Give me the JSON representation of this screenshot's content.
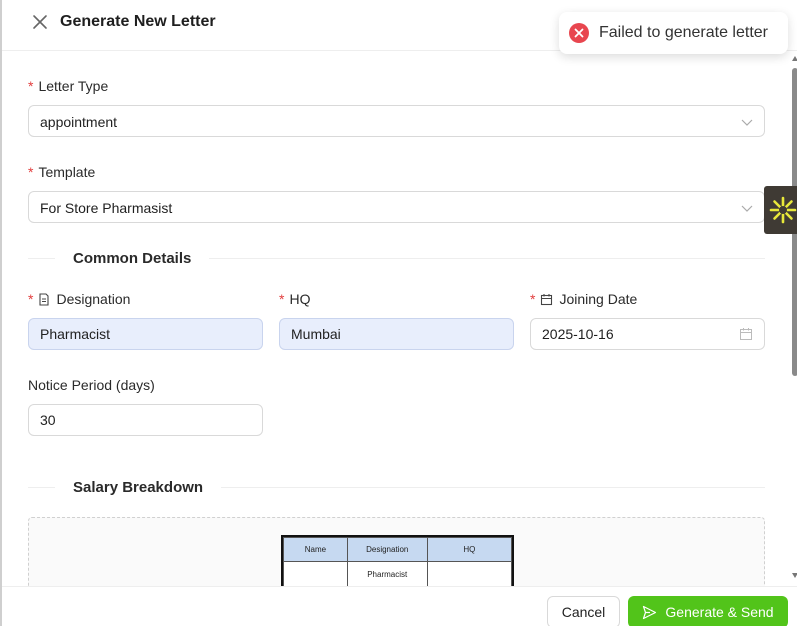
{
  "header": {
    "title": "Generate New Letter"
  },
  "toast": {
    "message": "Failed to generate letter",
    "color": "#e8464f"
  },
  "form": {
    "letter_type": {
      "label": "Letter Type",
      "value": "appointment",
      "required": true
    },
    "template": {
      "label": "Template",
      "value": "For Store Pharmasist",
      "required": true
    },
    "sections": {
      "common": "Common Details",
      "salary": "Salary Breakdown"
    },
    "designation": {
      "label": "Designation",
      "value": "Pharmacist",
      "required": true
    },
    "hq": {
      "label": "HQ",
      "value": "Mumbai",
      "required": true
    },
    "joining_date": {
      "label": "Joining Date",
      "value": "2025-10-16",
      "required": true
    },
    "notice_period": {
      "label": "Notice Period (days)",
      "value": "30"
    }
  },
  "salary_preview": {
    "headers": [
      "Name",
      "Designation",
      "HQ"
    ],
    "rows": [
      [
        "",
        "Pharmacist",
        ""
      ]
    ]
  },
  "footer": {
    "cancel_label": "Cancel",
    "submit_label": "Generate & Send"
  },
  "colors": {
    "primary": "#52c41a",
    "required": "#e23d3d",
    "filled_input": "#e8eefc",
    "widget_bg": "#3f3a34",
    "widget_icon": "#e8e83a"
  }
}
